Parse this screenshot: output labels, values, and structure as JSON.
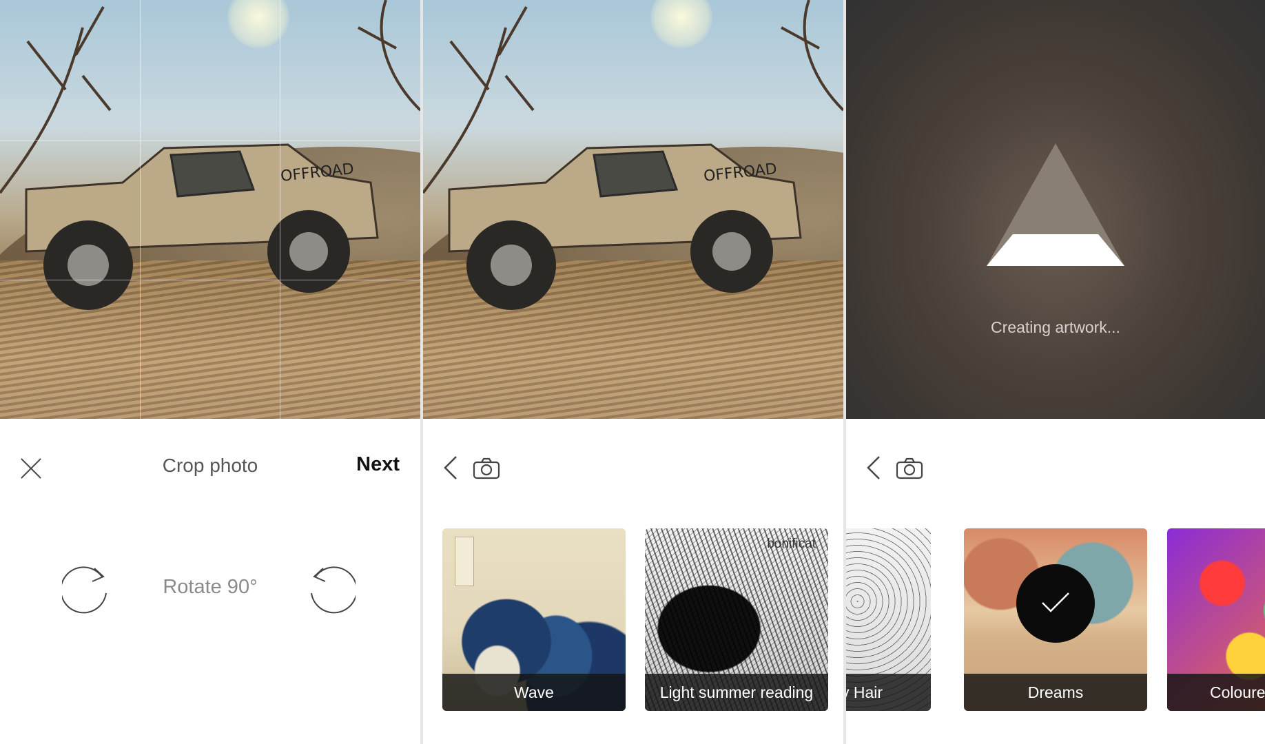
{
  "crop_screen": {
    "title": "Crop photo",
    "next_label": "Next",
    "rotate_label": "Rotate 90°"
  },
  "styles_screen": {
    "cards": [
      {
        "label": "Wave"
      },
      {
        "label": "Light summer reading",
        "brand": "bonificat"
      }
    ]
  },
  "loading_screen": {
    "status_text": "Creating artwork...",
    "cards": [
      {
        "label": "y Hair"
      },
      {
        "label": "Dreams",
        "selected": true
      },
      {
        "label": "Coloure"
      }
    ]
  },
  "colors": {
    "selected_badge": "#0b0b0b",
    "label_bar": "#141414"
  }
}
